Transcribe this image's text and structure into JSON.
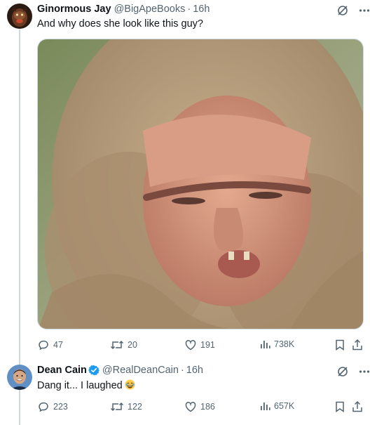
{
  "tweet1": {
    "display_name": "Ginormous Jay",
    "handle": "@BigApeBooks",
    "separator": "·",
    "time": "16h",
    "text": "And why does she look like this guy?",
    "stats": {
      "replies": "47",
      "reposts": "20",
      "likes": "191",
      "views": "738K"
    }
  },
  "tweet2": {
    "display_name": "Dean Cain",
    "handle": "@RealDeanCain",
    "separator": "·",
    "time": "16h",
    "text": "Dang it... I laughed",
    "stats": {
      "replies": "223",
      "reposts": "122",
      "likes": "186",
      "views": "657K"
    }
  },
  "colors": {
    "text": "#0f1419",
    "secondary": "#536471",
    "verified": "#1d9bf0",
    "thread_line": "#cfd9de"
  },
  "icons": [
    "grok-icon",
    "more-icon",
    "reply-icon",
    "repost-icon",
    "like-icon",
    "views-icon",
    "bookmark-icon",
    "share-icon",
    "verified-badge-icon",
    "laughing-emoji-icon"
  ]
}
